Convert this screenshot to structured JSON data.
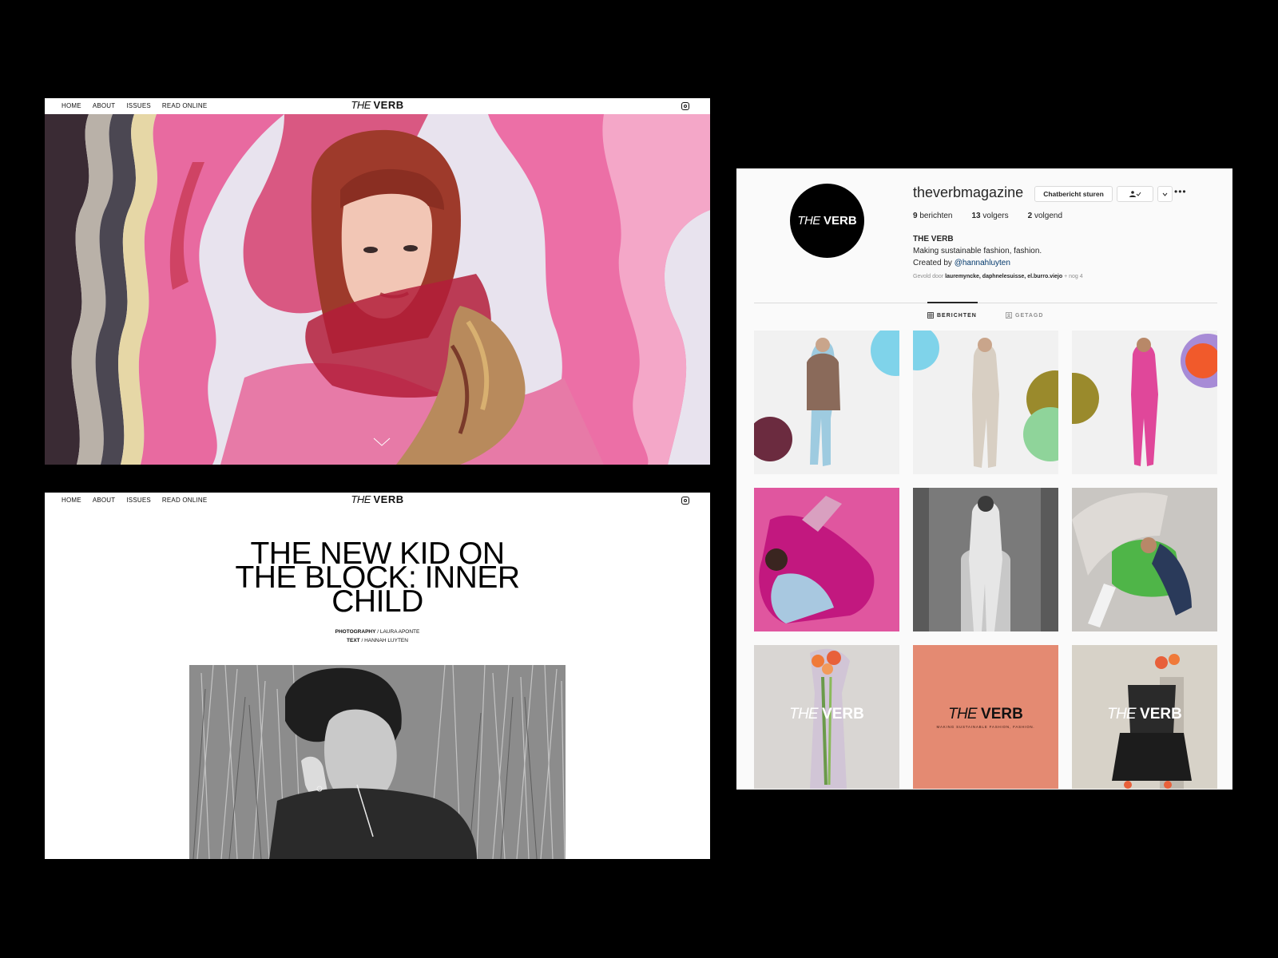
{
  "site": {
    "nav": [
      "HOME",
      "ABOUT",
      "ISSUES",
      "READ ONLINE"
    ],
    "logo": {
      "the": "THE",
      "verb": "VERB"
    }
  },
  "article": {
    "title_lines": [
      "THE NEW KID ON",
      "THE BLOCK: INNER",
      "CHILD"
    ],
    "credits": [
      {
        "role": "PHOTOGRAPHY",
        "name": "LAURA APONTE"
      },
      {
        "role": "TEXT",
        "name": "HANNAH LUYTEN"
      }
    ]
  },
  "instagram": {
    "username": "theverbmagazine",
    "message_button": "Chatbericht sturen",
    "stats": [
      {
        "count": "9",
        "label": "berichten"
      },
      {
        "count": "13",
        "label": "volgers"
      },
      {
        "count": "2",
        "label": "volgend"
      }
    ],
    "bio": {
      "name": "THE VERB",
      "line1": "Making sustainable fashion, fashion.",
      "created_prefix": "Created by",
      "handle": "@hannahluyten"
    },
    "followed_by": {
      "prefix": "Gevold door",
      "names": "lauremyncke, daphnelesuisse, el.burro.viejo",
      "suffix": "+ nog 4"
    },
    "tabs": [
      "BERICHTEN",
      "GETAGD"
    ],
    "tile_tagline": "MAKING SUSTAINABLE FASHION, FASHION.",
    "colors": {
      "link": "#00376b",
      "tile_coral": "#e48a72",
      "hero_pink": "#e86aa0"
    }
  }
}
